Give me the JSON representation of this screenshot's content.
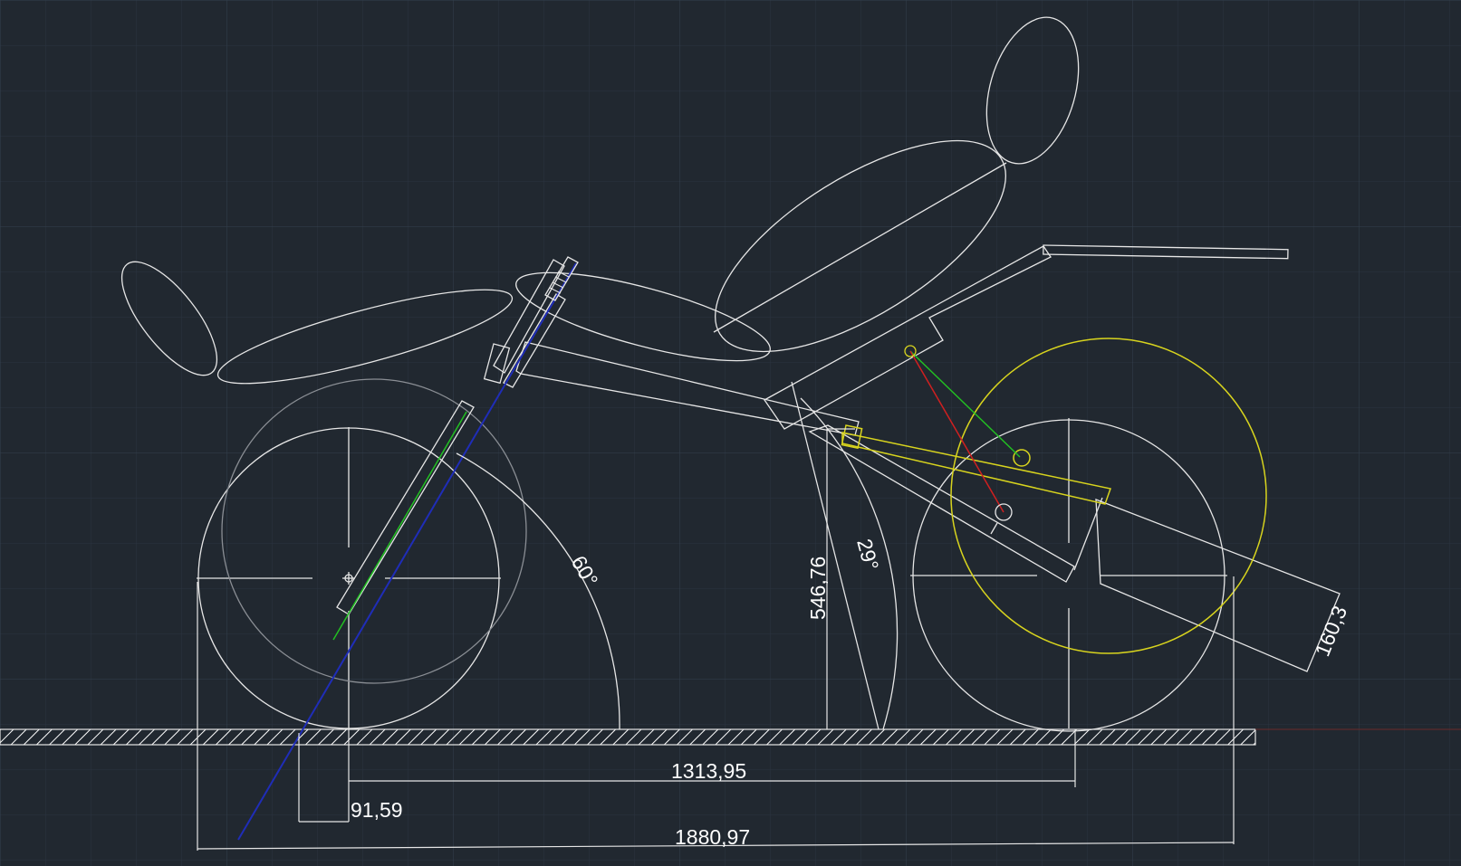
{
  "dimensions": {
    "wheelbase": "1313,95",
    "trail": "91,59",
    "overall_length": "1880,97",
    "seat_height": "546,76",
    "head_angle": "60°",
    "seat_angle": "29°",
    "crank_length": "160,3"
  },
  "colors": {
    "background": "#212830",
    "grid_minor": "#2a3340",
    "grid_major": "#34404e",
    "outline": "#e6e6e6",
    "steering_axis": "#1f2db8",
    "fork": "#22c022",
    "chain_ring": "#d8d41e",
    "link_green": "#22c022",
    "link_red": "#d02020",
    "ground_hatch": "#ffffff"
  }
}
